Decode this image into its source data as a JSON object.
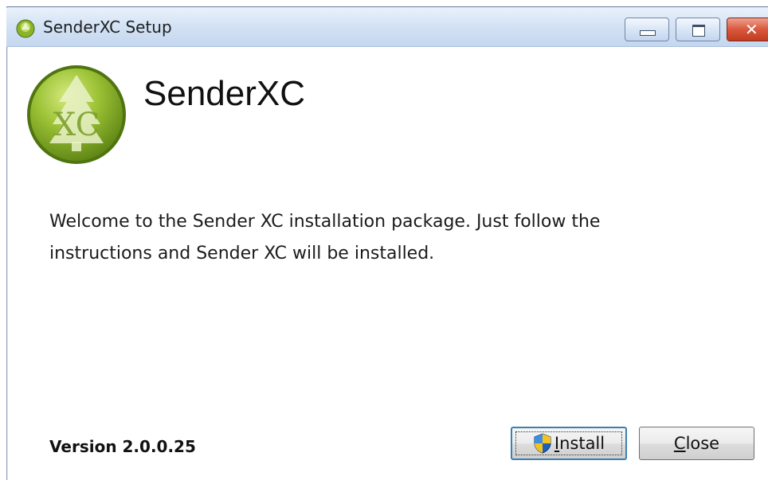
{
  "window": {
    "title": "SenderXC Setup",
    "controls": {
      "minimize_icon": "minimize-icon",
      "maximize_icon": "maximize-icon",
      "close_icon": "close-icon"
    }
  },
  "header": {
    "logo_icon": "senderxc-logo",
    "logo_text": "XC",
    "app_name": "SenderXC"
  },
  "body": {
    "welcome_text": "Welcome to the Sender XC installation package. Just follow the\ninstructions and Sender XC will be installed."
  },
  "footer": {
    "version": "Version 2.0.0.25",
    "install_label_mnemonic": "I",
    "install_label_rest": "nstall",
    "install_icon": "uac-shield-icon",
    "close_label_mnemonic": "C",
    "close_label_rest": "lose"
  },
  "colors": {
    "titlebar": "#d4e3f5",
    "close_button": "#d9573d",
    "logo_green": "#8ab52a",
    "focus_border": "#3c7fb1"
  }
}
